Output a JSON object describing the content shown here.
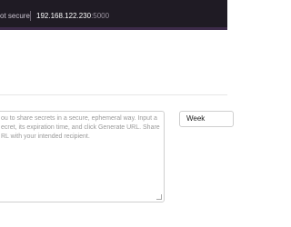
{
  "browser": {
    "security_label": "ot secure",
    "url_host": "192.168.122.230",
    "url_port": ":5000"
  },
  "form": {
    "secret_placeholder_lines": [
      "ou to share secrets in a secure, ephemeral way. Input a",
      "ecret, its expiration time, and click Generate URL. Share",
      "RL with your intended recipient."
    ],
    "expiration_value": "Week"
  }
}
